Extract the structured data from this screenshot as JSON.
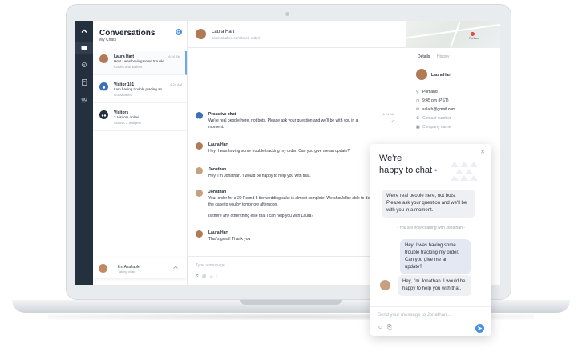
{
  "rail": {
    "icons": [
      "chevron-up-icon",
      "chat-icon",
      "gear-icon",
      "book-icon",
      "users-icon"
    ]
  },
  "conversations": {
    "title": "Conversations",
    "subtitle": "My Chats",
    "items": [
      {
        "name": "Laura Hart",
        "message": "Hey! I was having some trouble...",
        "meta": "Cakes and Bakes",
        "time": "6:24 AM"
      },
      {
        "name": "Visitor 101",
        "message": "I am having trouble placing an...",
        "meta": "Goodbakes",
        "time": "6:24 AM"
      },
      {
        "name": "Visitors",
        "message": "3 Visitors online",
        "meta": "Across 2 widgets",
        "time": ""
      }
    ],
    "status": {
      "title": "I'm Available",
      "subtitle": "Taking chats"
    }
  },
  "chat_header": {
    "name": "Laura Hart",
    "url": "cakesnbakes.com/track-order/"
  },
  "messages": [
    {
      "name": "Proactive chat",
      "text": "We're real people here, not bots. Please ask your question and we'll be with you in a moment.",
      "time": "6:24 AM"
    },
    {
      "name": "Laura Hart",
      "text": "Hey! I was having some trouble tracking my order. Can you give me an update?",
      "time": ""
    },
    {
      "name": "Jonathan",
      "text": "Hey, I'm Jonathan. I would be happy to help you with that.",
      "time": ""
    },
    {
      "name": "Jonathan",
      "text": "Your order for a 20 Pound 5 tier wedding cake is almost complete. We should be able to deliver the cake to you by tomorrow afternoon.",
      "text2": "Is there any other thing else that I can help you with Laura?",
      "time": ""
    },
    {
      "name": "Laura Hart",
      "text": "That's great! Thank you",
      "time": ""
    }
  ],
  "composer": {
    "placeholder": "Type a message"
  },
  "details": {
    "map_label": "Portland",
    "tabs": [
      "Details",
      "History"
    ],
    "name": "Laura Hart",
    "rows": [
      "Portland",
      "9:45 pm (PST)",
      "sala.b@gmail.com",
      "Contact number",
      "Company name"
    ]
  },
  "widget": {
    "title_line1": "We're",
    "title_line2": "happy to chat",
    "operator_msg": "We're real people here, not bots. Please ask your question and we'll be with you in a moment.",
    "divider": "- You are now chatting with Jonathan -",
    "user_msg": "Hey! I was having some trouble tracking my order. Can you give me an update?",
    "agent_msg": "Hey, I'm Jonathan. I would be happy to help you with that.",
    "input_placeholder": "Send your message to Jonathan..."
  },
  "colors": {
    "accent": "#4a90e2",
    "rail": "#25303e"
  }
}
